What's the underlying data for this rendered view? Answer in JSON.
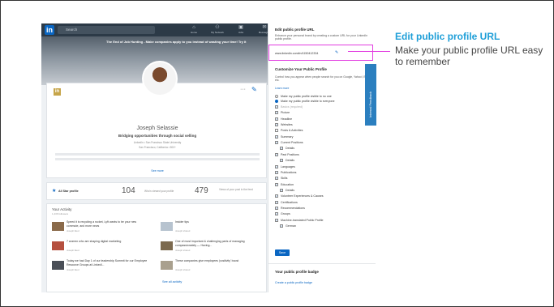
{
  "topbar": {
    "logo": "in",
    "search_placeholder": "Search",
    "nav": [
      {
        "icon": "home-icon",
        "label": "Home"
      },
      {
        "icon": "network-icon",
        "label": "My Network"
      },
      {
        "icon": "jobs-icon",
        "label": "Jobs"
      },
      {
        "icon": "messaging-icon",
        "label": "Messaging"
      }
    ]
  },
  "banner": {
    "text": "The End of Job Hunting - Make companies apply to you instead of wasting your time! Try it"
  },
  "profile": {
    "name": "Joseph Selassie",
    "headline": "Bridging opportunities through social selling",
    "company": "LinkedIn • San Francisco State University",
    "location": "San Francisco, California • 500+",
    "see_more": "See more"
  },
  "stats": {
    "all_star": "All Star profile",
    "views": "104",
    "views_label": "Who's viewed your profile",
    "post_views": "479",
    "post_views_label": "Views of your post in the feed"
  },
  "activity": {
    "title": "Your Activity",
    "followers": "1,436 followers",
    "posts": [
      {
        "title": "Speed it is recycling a rocket, Lyft wants to be your new commute, and more news",
        "by": "Joseph liked"
      },
      {
        "title": "Insider tips",
        "by": "Joseph shared"
      },
      {
        "title": "7 women who are shaping digital marketing",
        "by": "Joseph liked"
      },
      {
        "title": "One of most important & challenging parts of managing compassionately — Having...",
        "by": "Joseph shared"
      },
      {
        "title": "Today we had Day 1 of our leadership Summit for our Employee Resource Groups at LinkedI...",
        "by": "Joseph liked"
      },
      {
        "title": "These companies give employees 'positivity' boost",
        "by": "Joseph shared"
      }
    ],
    "see_all": "See all activity"
  },
  "side": {
    "url_title": "Edit public profile URL",
    "url_desc": "Enhance your personal brand by creating a custom URL for your LinkedIn public profile.",
    "url": "www.linkedin.com/in/4150412334",
    "customize_title": "Customize Your Public Profile",
    "customize_desc": "Control how you appear when people search for you on Google, Yahoo!, Bing, etc.",
    "learn_more": "Learn more",
    "radio_options": [
      {
        "label": "Make my public profile visible to no one",
        "selected": false
      },
      {
        "label": "Make my public profile visible to everyone",
        "selected": true
      }
    ],
    "checkboxes": [
      {
        "label": "Basics (required)",
        "checked": true,
        "indent": 0,
        "dim": true
      },
      {
        "label": "Picture",
        "checked": true,
        "indent": 0
      },
      {
        "label": "Headline",
        "checked": true,
        "indent": 0
      },
      {
        "label": "Websites",
        "checked": true,
        "indent": 0
      },
      {
        "label": "Posts & Activities",
        "checked": false,
        "indent": 0
      },
      {
        "label": "Summary",
        "checked": true,
        "indent": 0
      },
      {
        "label": "Current Positions",
        "checked": true,
        "indent": 0
      },
      {
        "label": "Details",
        "checked": true,
        "indent": 1
      },
      {
        "label": "Past Positions",
        "checked": true,
        "indent": 0
      },
      {
        "label": "Details",
        "checked": true,
        "indent": 1
      },
      {
        "label": "Languages",
        "checked": true,
        "indent": 0
      },
      {
        "label": "Publications",
        "checked": true,
        "indent": 0
      },
      {
        "label": "Skills",
        "checked": true,
        "indent": 0
      },
      {
        "label": "Education",
        "checked": true,
        "indent": 0
      },
      {
        "label": "Details",
        "checked": true,
        "indent": 1
      },
      {
        "label": "Volunteer Experiences & Causes",
        "checked": true,
        "indent": 0
      },
      {
        "label": "Certifications",
        "checked": true,
        "indent": 0
      },
      {
        "label": "Recommendations",
        "checked": true,
        "indent": 0
      },
      {
        "label": "Groups",
        "checked": true,
        "indent": 0
      },
      {
        "label": "Machine-translated Public Profile",
        "checked": true,
        "indent": 0
      },
      {
        "label": "German",
        "checked": true,
        "indent": 1
      }
    ],
    "save": "Save",
    "badge_title": "Your public profile badge",
    "badge_link": "Create a public profile badge"
  },
  "feedback_tab": "Internal Feedback",
  "callout": {
    "title": "Edit public profile URL",
    "body": "Make your public profile URL easy to remember"
  },
  "colors": {
    "linkedin_blue": "#0a66c2",
    "highlight": "#e23ce0",
    "callout_title": "#1f9fd8"
  }
}
